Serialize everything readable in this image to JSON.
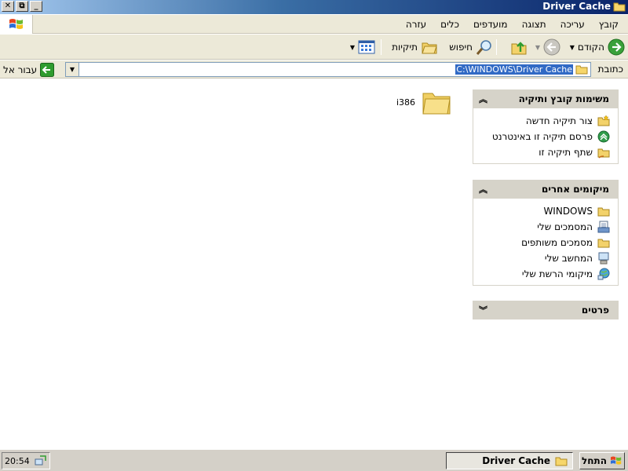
{
  "window": {
    "title": "Driver Cache",
    "icon": "folder-icon",
    "caption_buttons": {
      "close": "✕",
      "restore": "⧉",
      "minimize": "_"
    }
  },
  "menubar": {
    "items": [
      "קובץ",
      "עריכה",
      "תצוגה",
      "מועדפים",
      "כלים",
      "עזרה"
    ]
  },
  "toolbar": {
    "back_label": "הקודם",
    "search_label": "חיפוש",
    "folders_label": "תיקיות"
  },
  "addressbar": {
    "label": "כתובת",
    "value": "C:\\WINDOWS\\Driver Cache",
    "go_label": "עבור אל"
  },
  "panels": {
    "file_tasks": {
      "title": "משימות קובץ ותיקיה",
      "items": [
        {
          "label": "צור תיקיה חדשה",
          "icon": "new-folder-icon"
        },
        {
          "label": "פרסם תיקיה זו באינטרנט",
          "icon": "publish-web-icon"
        },
        {
          "label": "שתף תיקיה זו",
          "icon": "share-folder-icon"
        }
      ]
    },
    "other_places": {
      "title": "מיקומים אחרים",
      "items": [
        {
          "label": "WINDOWS",
          "icon": "folder-icon"
        },
        {
          "label": "המסמכים שלי",
          "icon": "my-documents-icon"
        },
        {
          "label": "מסמכים משותפים",
          "icon": "shared-documents-icon"
        },
        {
          "label": "המחשב שלי",
          "icon": "my-computer-icon"
        },
        {
          "label": "מיקומי הרשת שלי",
          "icon": "network-places-icon"
        }
      ]
    },
    "details": {
      "title": "פרטים"
    }
  },
  "files": [
    {
      "name": "i386",
      "icon": "folder-icon"
    }
  ],
  "taskbar": {
    "start_label": "התחל",
    "window_button": "Driver Cache",
    "clock": "20:54"
  },
  "colors": {
    "title_bar": "#0a246a",
    "panel_header": "#d6d3c9",
    "address_highlight": "#316ac5",
    "go_button": "#2f9c2f"
  }
}
